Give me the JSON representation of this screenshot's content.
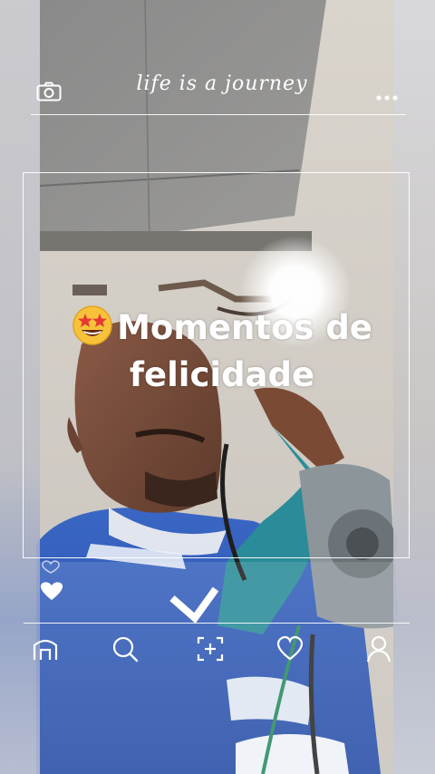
{
  "header": {
    "brand_text": "life is a journey",
    "camera_icon": "camera-icon",
    "more_icon": "more-dots-icon"
  },
  "post": {
    "title_emoji": "star-struck-emoji",
    "title_text": "Momentos de felicidade"
  },
  "reactions": {
    "heart_small_icon": "heart-outline-icon",
    "heart_filled_icon": "heart-filled-icon"
  },
  "bottom_nav": {
    "items": [
      {
        "icon": "home-icon"
      },
      {
        "icon": "search-icon"
      },
      {
        "icon": "add-post-icon"
      },
      {
        "icon": "heart-icon"
      },
      {
        "icon": "profile-icon"
      }
    ]
  },
  "colors": {
    "overlay_line": "#ffffff",
    "jersey_blue": "#2f5bb7",
    "tool_teal": "#2a8c98"
  }
}
